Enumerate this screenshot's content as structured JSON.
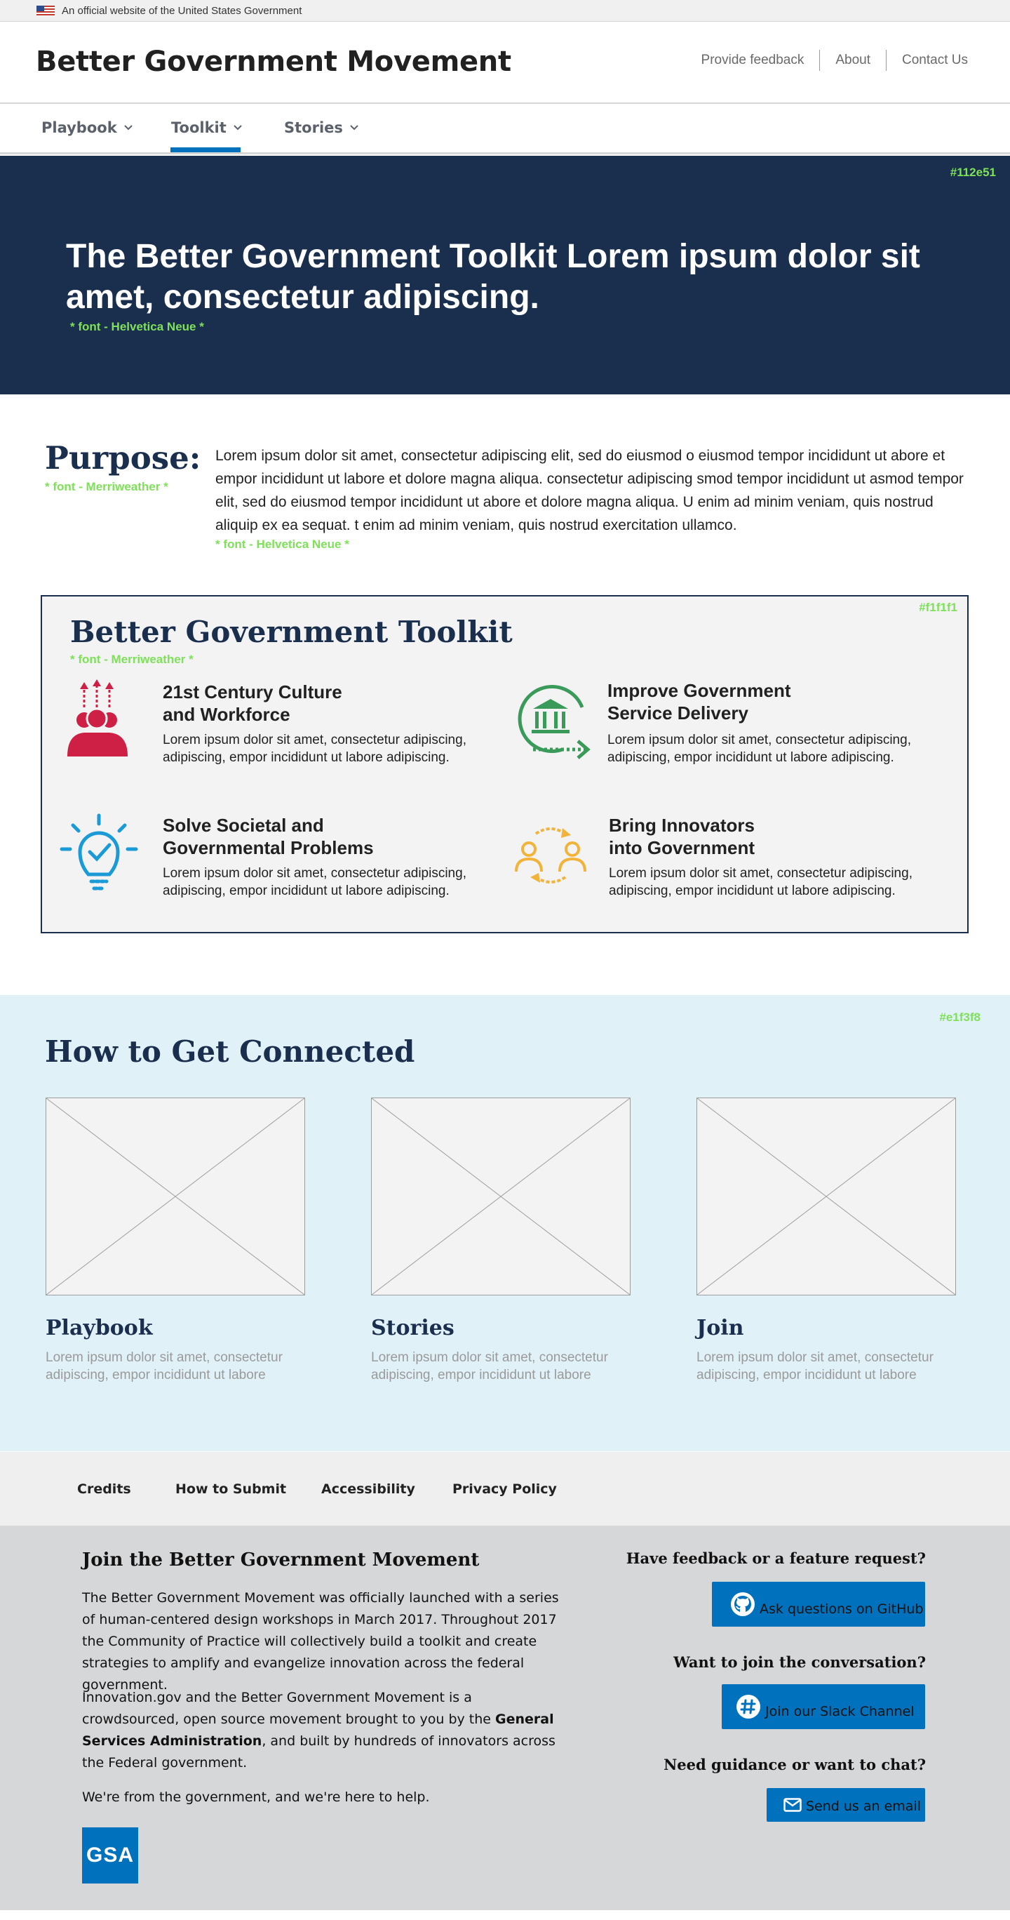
{
  "gov_banner": {
    "text": "An official website of the United States Government",
    "flag_icon": "us-flag-icon"
  },
  "header": {
    "site_title": "Better Government Movement",
    "links": [
      "Provide feedback",
      "About",
      "Contact Us"
    ]
  },
  "nav": {
    "items": [
      {
        "label": "Playbook",
        "icon": "chevron-down-icon"
      },
      {
        "label": "Toolkit",
        "icon": "chevron-down-icon",
        "active": true
      },
      {
        "label": "Stories",
        "icon": "chevron-down-icon"
      }
    ]
  },
  "hero": {
    "color_note": "#112e51",
    "title": "The Better Government Toolkit Lorem ipsum dolor sit amet, consectetur adipiscing.",
    "font_note": "* font - Helvetica Neue *"
  },
  "purpose": {
    "heading": "Purpose:",
    "font_note": "* font - Merriweather *",
    "text": "Lorem ipsum dolor sit amet, consectetur adipiscing elit,  sed do eiusmod  o eiusmod tempor incididunt ut abore et empor incididunt ut labore et dolore magna aliqua.  consectetur adipiscing smod tempor incididunt ut asmod tempor elit,  sed do eiusmod tempor incididunt ut abore et dolore magna aliqua. U enim ad minim veniam, quis nostrud aliquip ex ea sequat. t enim ad minim veniam, quis nostrud  exercitation ullamco.",
    "text_font_note": "* font - Helvetica Neue *"
  },
  "toolkit": {
    "color_note": "#f1f1f1",
    "title": "Better Government Toolkit",
    "font_note": "* font - Merriweather *",
    "items": [
      {
        "title_line1": "21st Century Culture",
        "title_line2": "and Workforce",
        "desc": "Lorem ipsum dolor sit amet, consectetur adipiscing, adipiscing, empor incididunt ut labore adipiscing.",
        "icon": "people-arrows-icon",
        "color": "#cd2044"
      },
      {
        "title_line1": "Improve Government",
        "title_line2": "Service Delivery",
        "desc": "Lorem ipsum dolor sit amet, consectetur adipiscing, adipiscing, empor incididunt ut labore adipiscing.",
        "icon": "government-building-icon",
        "color": "#3a9a5a"
      },
      {
        "title_line1": "Solve Societal and",
        "title_line2": "Governmental Problems",
        "desc": "Lorem ipsum dolor sit amet, consectetur adipiscing, adipiscing, empor incididunt ut labore adipiscing.",
        "icon": "lightbulb-check-icon",
        "color": "#1a9ad6"
      },
      {
        "title_line1": "Bring Innovators",
        "title_line2": "into Government",
        "desc": "Lorem ipsum dolor sit amet, consectetur adipiscing, adipiscing, empor incididunt ut labore adipiscing.",
        "icon": "people-exchange-icon",
        "color": "#f2b33a"
      }
    ]
  },
  "connected": {
    "color_note": "#e1f3f8",
    "title": "How to Get Connected",
    "cards": [
      {
        "title": "Playbook",
        "desc": "Lorem ipsum dolor sit amet, consectetur adipiscing, empor incididunt ut labore"
      },
      {
        "title": "Stories",
        "desc": "Lorem ipsum dolor sit amet, consectetur adipiscing, empor incididunt ut labore"
      },
      {
        "title": "Join",
        "desc": "Lorem ipsum dolor sit amet, consectetur adipiscing, empor incididunt ut labore"
      }
    ]
  },
  "footer_links": [
    "Credits",
    "How to Submit",
    "Accessibility",
    "Privacy Policy"
  ],
  "footer": {
    "heading": "Join the Better Government Movement",
    "para1": "The Better Government Movement was officially launched with a series of human-centered design workshops in March 2017. Throughout 2017 the Community of Practice will collectively build a toolkit and create strategies to amplify and evangelize innovation across the federal government.",
    "para2_before": "Innovation.gov and the Better Government Movement is a crowdsourced, open source movement brought to you by the ",
    "para2_bold": "General Services Administration",
    "para2_after": ", and built by hundreds of innovators across the Federal government.",
    "para3": "We're from the government, and we're here to help.",
    "logo_text": "GSA",
    "q1": "Have feedback or a feature request?",
    "btn1": "Ask questions on GitHub",
    "q2": "Want to join the conversation?",
    "btn2": "Join our Slack Channel",
    "q3": "Need guidance or want to chat?",
    "btn3": "Send us an email"
  }
}
